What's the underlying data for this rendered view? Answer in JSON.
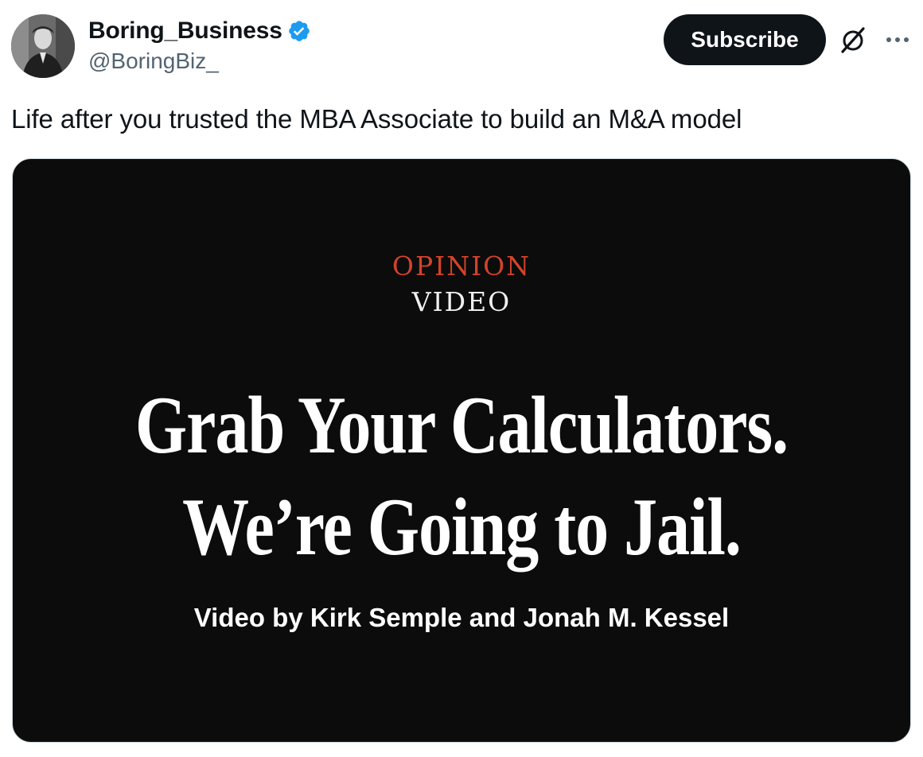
{
  "author": {
    "display_name": "Boring_Business",
    "handle": "@BoringBiz_",
    "avatar_icon": "portrait-photo",
    "verified_icon": "verified-badge-icon",
    "verified_color": "#1d9bf0"
  },
  "actions": {
    "subscribe_label": "Subscribe",
    "grok_icon": "grok-icon",
    "more_icon": "more-options-icon"
  },
  "tweet": {
    "text": "Life after you trusted the MBA Associate to build an M&A model"
  },
  "media": {
    "section_label": "OPINION",
    "section_sub": "VIDEO",
    "headline_line1": "Grab Your Calculators.",
    "headline_line2": "We’re Going to Jail.",
    "byline": "Video by Kirk Semple and Jonah M. Kessel",
    "background_color": "#0c0c0c",
    "section_color": "#d2432b"
  }
}
